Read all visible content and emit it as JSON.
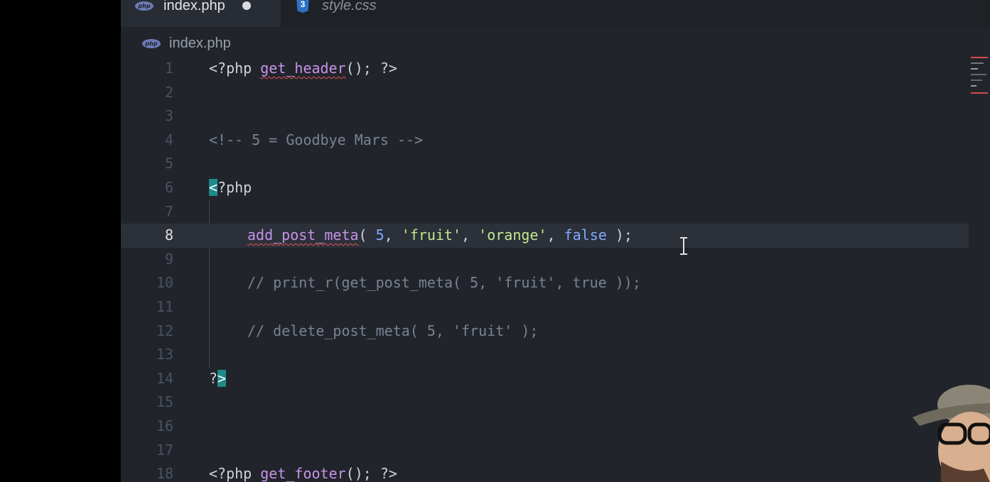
{
  "tabs": [
    {
      "label": "index.php",
      "icon": "php-icon",
      "icon_text": "php",
      "modified": true,
      "active": true
    },
    {
      "label": "style.css",
      "icon": "css3-icon",
      "icon_text": "3",
      "active": false
    }
  ],
  "breadcrumb": {
    "icon_text": "php",
    "label": "index.php"
  },
  "editor": {
    "current_line": 8,
    "line_numbers": [
      "1",
      "2",
      "3",
      "4",
      "5",
      "6",
      "7",
      "8",
      "9",
      "10",
      "11",
      "12",
      "13",
      "14",
      "15",
      "16",
      "17",
      "18"
    ],
    "code": {
      "l1_open": "<?php ",
      "l1_func": "get_header",
      "l1_rest": "(); ?>",
      "l4_comment": "<!-- 5 = Goodbye Mars -->",
      "l6_bracket": "<",
      "l6_rest": "?php",
      "l8_func": "add_post_meta",
      "l8_p1": "( ",
      "l8_num": "5",
      "l8_p2": ", ",
      "l8_s1": "'fruit'",
      "l8_p3": ", ",
      "l8_s2": "'orange'",
      "l8_p4": ", ",
      "l8_kw": "false",
      "l8_p5": " );",
      "l10_comment": "// print_r(get_post_meta( 5, 'fruit', true ));",
      "l12_comment": "// delete_post_meta( 5, 'fruit' );",
      "l14_q": "?",
      "l14_bracket": ">",
      "l18_open": "<?php ",
      "l18_func": "get_footer",
      "l18_rest": "(); ?>"
    }
  },
  "colors": {
    "editor_bg": "#21252b",
    "function": "#c792ea",
    "string": "#c3e88d",
    "number": "#82aaff",
    "comment": "#7a8291",
    "bracket_match": "#1f8a8a",
    "error_squiggle": "#e05252"
  }
}
